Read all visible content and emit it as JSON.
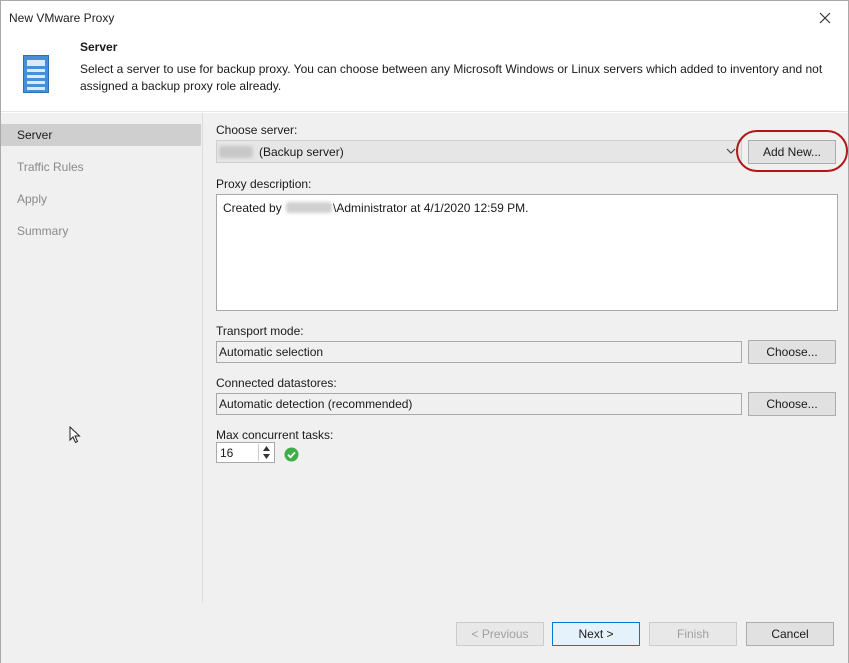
{
  "window": {
    "title": "New VMware Proxy"
  },
  "header": {
    "title": "Server",
    "description": "Select a server to use for backup proxy. You can choose between any Microsoft Windows or Linux servers which added to inventory and not assigned a backup proxy role already."
  },
  "sidebar": {
    "items": [
      {
        "label": "Server",
        "active": true
      },
      {
        "label": "Traffic Rules",
        "active": false
      },
      {
        "label": "Apply",
        "active": false
      },
      {
        "label": "Summary",
        "active": false
      }
    ]
  },
  "form": {
    "choose_server_label": "Choose server:",
    "choose_server_value": "(Backup server)",
    "add_new_label": "Add New...",
    "proxy_description_label": "Proxy description:",
    "proxy_description_prefix": "Created by",
    "proxy_description_suffix": "\\Administrator at 4/1/2020 12:59 PM.",
    "transport_mode_label": "Transport mode:",
    "transport_mode_value": "Automatic selection",
    "transport_choose_label": "Choose...",
    "datastores_label": "Connected datastores:",
    "datastores_value": "Automatic detection (recommended)",
    "datastores_choose_label": "Choose...",
    "max_tasks_label": "Max concurrent tasks:",
    "max_tasks_value": "16"
  },
  "footer": {
    "previous_label": "< Previous",
    "next_label": "Next >",
    "finish_label": "Finish",
    "cancel_label": "Cancel"
  },
  "colors": {
    "highlight": "#b01818",
    "accent": "#0078d7",
    "ok_green": "#3fae49"
  }
}
